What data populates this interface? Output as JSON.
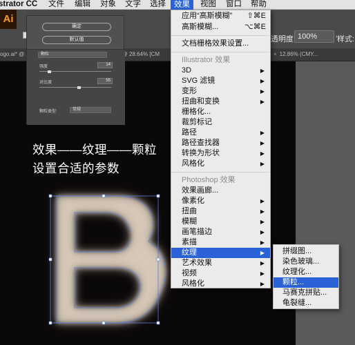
{
  "menubar": {
    "app": "strator CC",
    "items": [
      "文件",
      "编辑",
      "对象",
      "文字",
      "选择",
      "效果",
      "视图",
      "窗口",
      "帮助"
    ]
  },
  "toolbar": {
    "logo": "Ai",
    "opacity_label": "透明度:",
    "opacity_value": "100%",
    "style_label": "样式:"
  },
  "tabs": [
    {
      "label": "ogo.ai* @"
    },
    {
      "label": "@ 28.64% [CM"
    },
    {
      "label": "12.86% (CMY..."
    }
  ],
  "dialog": {
    "ok": "确定",
    "default": "默认值",
    "filter": "颗粒",
    "intensity_label": "强度",
    "intensity_value": "14",
    "contrast_label": "对比度",
    "contrast_value": "55",
    "type_label": "颗粒类型:",
    "type_value": "常规"
  },
  "caption": {
    "line1": "效果——纹理——颗粒",
    "line2": "设置合适的参数"
  },
  "effect_menu": {
    "apply": "应用“高斯模糊”",
    "apply_shortcut": "⇧⌘E",
    "gaussian": "高斯模糊...",
    "gaussian_shortcut": "⌥⌘E",
    "raster_settings": "文档栅格效果设置...",
    "illustrator_header": "Illustrator 效果",
    "illustrator_items": [
      "3D",
      "SVG 滤镜",
      "变形",
      "扭曲和变换",
      "栅格化...",
      "裁剪标记",
      "路径",
      "路径查找器",
      "转换为形状",
      "风格化"
    ],
    "photoshop_header": "Photoshop 效果",
    "photoshop_items": [
      "效果画廊...",
      "像素化",
      "扭曲",
      "模糊",
      "画笔描边",
      "素描",
      "纹理",
      "艺术效果",
      "视频",
      "风格化"
    ]
  },
  "texture_submenu": {
    "items": [
      "拼缀图...",
      "染色玻璃...",
      "纹理化...",
      "颗粒...",
      "马赛克拼贴...",
      "龟裂缝..."
    ]
  },
  "colors": {
    "menu_highlight": "#2a62d6",
    "selection": "#5d7dd8"
  }
}
